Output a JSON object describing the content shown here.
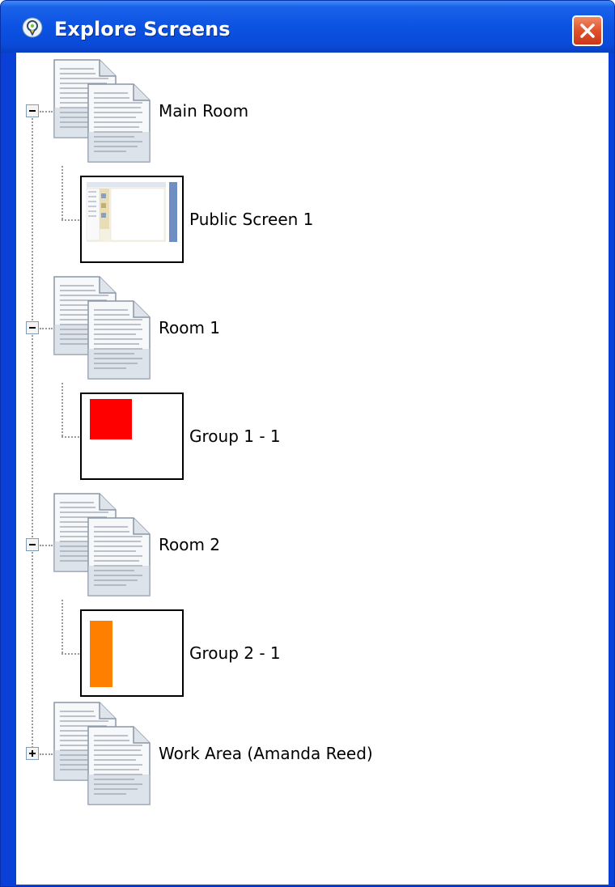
{
  "window": {
    "title": "Explore Screens"
  },
  "tree": {
    "rooms": [
      {
        "label": "Main Room",
        "expanded": true,
        "screens": [
          {
            "label": "Public Screen 1",
            "thumbnail": "app-screenshot"
          }
        ]
      },
      {
        "label": "Room 1",
        "expanded": true,
        "screens": [
          {
            "label": "Group 1 - 1",
            "thumbnail": "red-square",
            "color": "#ff0000"
          }
        ]
      },
      {
        "label": "Room 2",
        "expanded": true,
        "screens": [
          {
            "label": "Group 2 - 1",
            "thumbnail": "orange-bar",
            "color": "#ff7f00"
          }
        ]
      },
      {
        "label": "Work Area (Amanda Reed)",
        "expanded": false,
        "screens": []
      }
    ]
  },
  "icons": {
    "title": "app-lightbulb-icon",
    "close": "close-icon",
    "room": "document-stack-icon",
    "collapse": "minus-icon",
    "expand": "plus-icon"
  },
  "colors": {
    "titlebar": "#0b52e2",
    "close_button": "#e0502a"
  }
}
